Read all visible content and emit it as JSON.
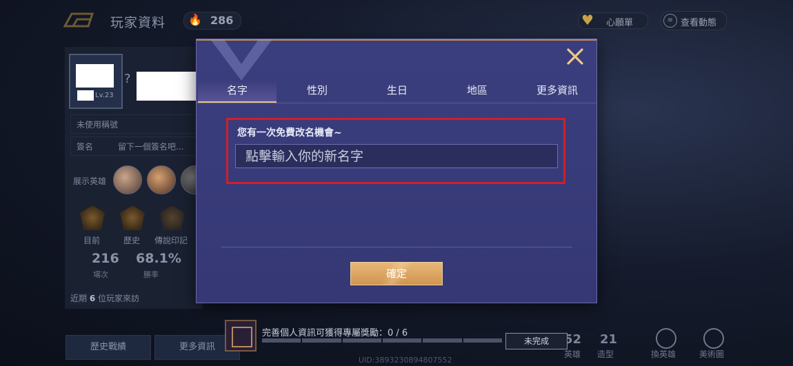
{
  "header": {
    "title": "玩家資料",
    "currency_value": "286",
    "wishlist_label": "心願單",
    "dynamics_label": "查看動態"
  },
  "profile": {
    "level": "Lv.23",
    "title_row": "未使用稱號",
    "signature_label": "簽名",
    "signature_placeholder": "留下一個簽名吧...",
    "heroes_label": "展示英雄",
    "medals": [
      "目前",
      "歷史",
      "傳說印記"
    ],
    "matches_value": "216",
    "matches_label": "場次",
    "winrate_value": "68.1%",
    "winrate_label": "勝率",
    "recent_prefix": "近期",
    "recent_count": "6",
    "recent_suffix": "位玩家來訪",
    "history_button": "歷史戰績",
    "more_button": "更多資訊"
  },
  "right_stats": {
    "heroes_value": "52",
    "heroes_label": "英雄",
    "skins_value": "21",
    "skins_label": "造型",
    "btn1_label": "換英雄",
    "btn2_label": "美術圖"
  },
  "uid": "UID:3893230894807552",
  "progress": {
    "text": "完善個人資訊可獲得專屬獎勵：0 / 6",
    "done": 0,
    "total": 6,
    "status_button": "未完成"
  },
  "modal": {
    "tabs": [
      "名字",
      "性別",
      "生日",
      "地區",
      "更多資訊"
    ],
    "active_tab": 0,
    "hint": "您有一次免費改名機會~",
    "input_placeholder": "點擊輸入你的新名字",
    "input_value": "",
    "confirm_label": "確定"
  },
  "colors": {
    "modal_bg": "#3b3e7e",
    "accent_gold": "#e9c684",
    "highlight_red": "#d01f2a",
    "confirm_gold": "#d9a463"
  },
  "icons": [
    "back-arrow-icon",
    "flame-icon",
    "heart-icon",
    "dynamics-icon",
    "close-icon",
    "reward-frame-icon"
  ]
}
